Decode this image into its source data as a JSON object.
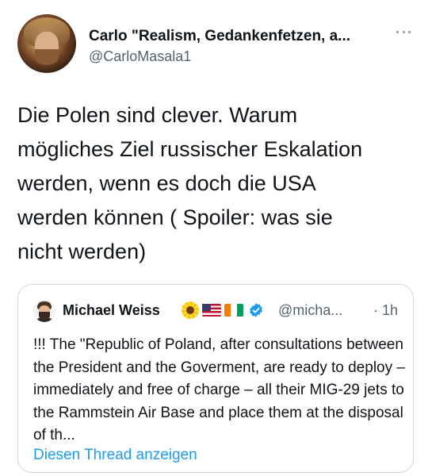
{
  "author": {
    "display_name": "Carlo \"Realism, Gedankenfetzen, a...",
    "handle": "@CarloMasala1"
  },
  "tweet": {
    "text": "Die Polen sind clever. Warum\nmögliches Ziel russischer Eskalation\nwerden, wenn es doch die USA\nwerden können ( Spoiler: was sie\nnicht werden)"
  },
  "quoted": {
    "display_name": "Michael Weiss",
    "emoji_icons": [
      "sunflower-icon",
      "us-flag-icon",
      "ivory-coast-flag-icon"
    ],
    "verified": true,
    "handle": "@micha...",
    "separator": "·",
    "time": "1h",
    "text": "!!! The \"Republic of Poland, after consultations between the President and the Goverment, are ready to deploy – immediately and free of charge – all their MIG-29 jets to the Rammstein Air Base and place them at the disposal of th...",
    "show_thread_label": "Diesen Thread anzeigen"
  },
  "colors": {
    "text_primary": "#0f1419",
    "text_secondary": "#536471",
    "link": "#1d9bf0",
    "border": "#cfd9de",
    "verified_badge": "#1d9bf0"
  }
}
